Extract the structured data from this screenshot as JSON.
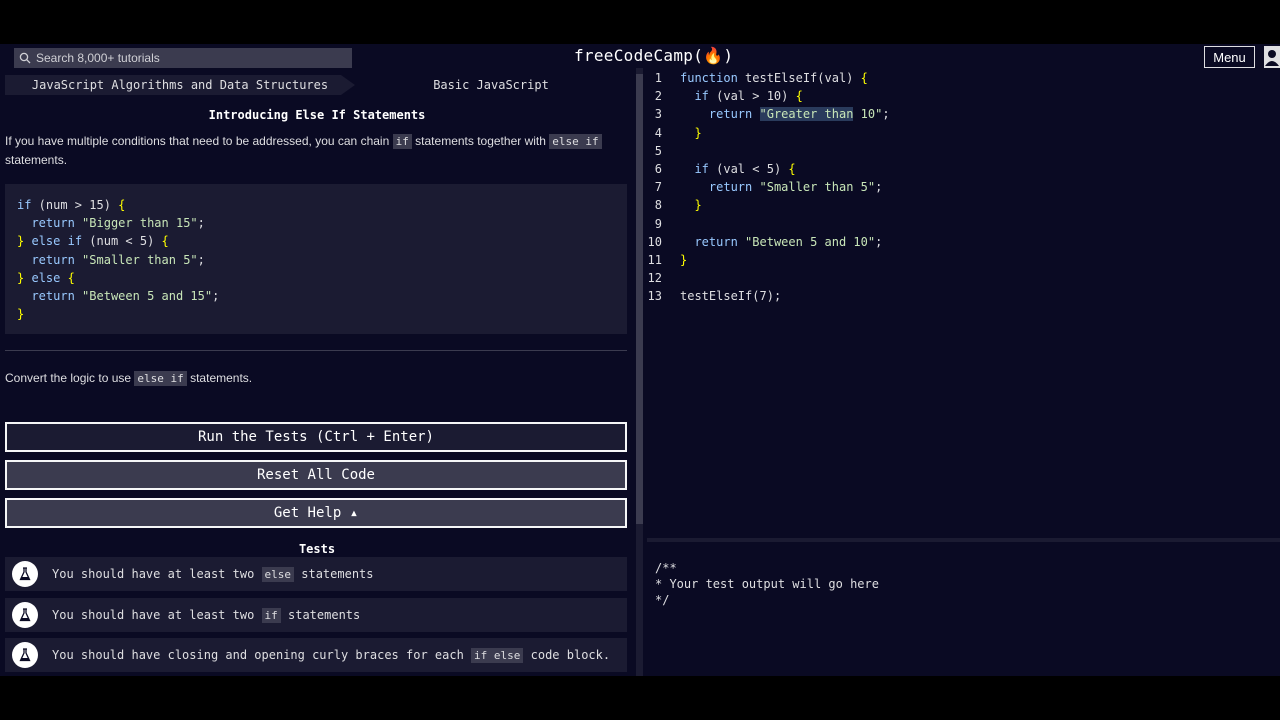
{
  "navbar": {
    "search_placeholder": "Search 8,000+ tutorials",
    "brand": "freeCodeCamp(🔥)",
    "menu_label": "Menu"
  },
  "breadcrumb": {
    "superblock": "JavaScript Algorithms and Data Structures",
    "block": "Basic JavaScript"
  },
  "challenge": {
    "title": "Introducing Else If Statements",
    "desc_part1": "If you have multiple conditions that need to be addressed, you can chain ",
    "desc_code1": "if",
    "desc_part2": " statements together with ",
    "desc_code2": "else if",
    "desc_part3": " statements.",
    "instructions_part1": "Convert the logic to use ",
    "instructions_code": "else if",
    "instructions_part2": " statements."
  },
  "example_code": [
    "if (num > 15) {",
    "  return \"Bigger than 15\";",
    "} else if (num < 5) {",
    "  return \"Smaller than 5\";",
    "} else {",
    "  return \"Between 5 and 15\";",
    "}"
  ],
  "buttons": {
    "run": "Run the Tests (Ctrl + Enter)",
    "reset": "Reset All Code",
    "help": "Get Help ▴"
  },
  "tests": {
    "heading": "Tests",
    "items": [
      {
        "pre": "You should have at least two ",
        "code": "else",
        "post": " statements"
      },
      {
        "pre": "You should have at least two ",
        "code": "if",
        "post": " statements"
      },
      {
        "pre": "You should have closing and opening curly braces for each ",
        "code": "if else",
        "post": " code block."
      }
    ]
  },
  "editor": {
    "lines": [
      {
        "n": "1",
        "code": "function testElseIf(val) {"
      },
      {
        "n": "2",
        "code": "  if (val > 10) {"
      },
      {
        "n": "3",
        "code": "    return \"Greater than 10\";"
      },
      {
        "n": "4",
        "code": "  }"
      },
      {
        "n": "5",
        "code": ""
      },
      {
        "n": "6",
        "code": "  if (val < 5) {"
      },
      {
        "n": "7",
        "code": "    return \"Smaller than 5\";"
      },
      {
        "n": "8",
        "code": "  }"
      },
      {
        "n": "9",
        "code": ""
      },
      {
        "n": "10",
        "code": "  return \"Between 5 and 10\";"
      },
      {
        "n": "11",
        "code": "}"
      },
      {
        "n": "12",
        "code": ""
      },
      {
        "n": "13",
        "code": "testElseIf(7);"
      }
    ]
  },
  "output": {
    "text": "/**\n* Your test output will go here\n*/"
  },
  "colors": {
    "background": "#0a0a23",
    "panel": "#1b1b32",
    "code_bg": "#3b3b4f",
    "keyword": "#99c9ff",
    "string": "#c8e6b8"
  }
}
